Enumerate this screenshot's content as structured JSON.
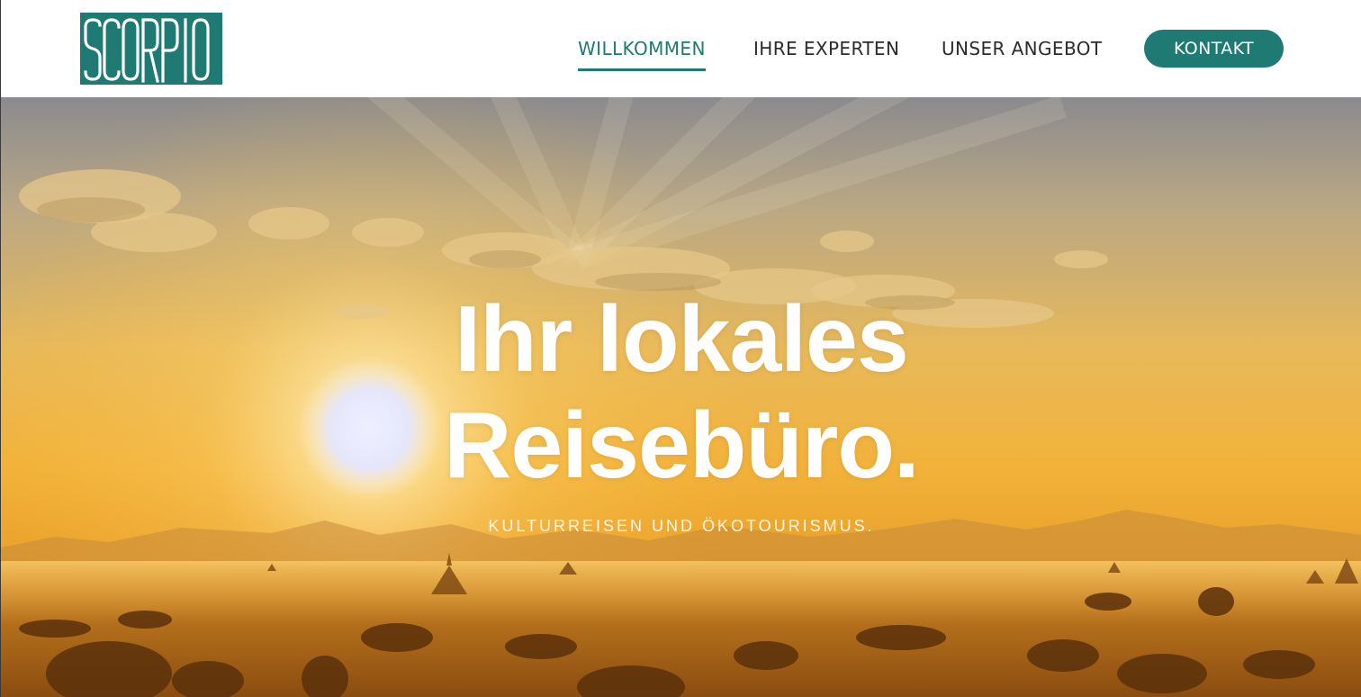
{
  "header": {
    "logo_text": "SCORPIO",
    "nav": [
      {
        "label": "WILLKOMMEN",
        "active": true
      },
      {
        "label": "IHRE EXPERTEN",
        "active": false
      },
      {
        "label": "UNSER ANGEBOT",
        "active": false
      }
    ],
    "contact_label": "KONTAKT"
  },
  "hero": {
    "title_line1": "Ihr lokales",
    "title_line2": "Reisebüro.",
    "subtitle": "KULTURREISEN UND ÖKOTOURISMUS."
  },
  "colors": {
    "brand": "#1e7a73",
    "nav_text": "#2b2b2b",
    "hero_text": "#ffffff"
  }
}
